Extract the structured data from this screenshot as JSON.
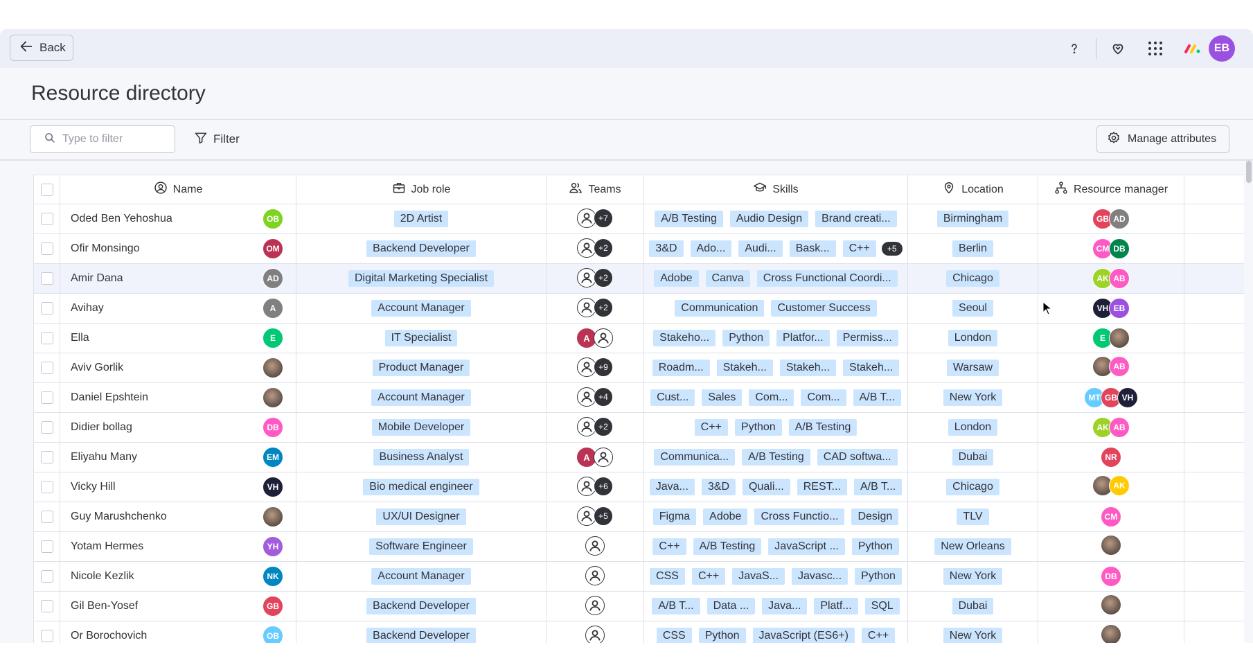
{
  "topbar": {
    "back_label": "Back",
    "user_initials": "EB",
    "user_color": "#9b51e0",
    "icons": [
      "help-icon",
      "heart-icon",
      "apps-grid-icon",
      "monday-logo-icon"
    ]
  },
  "page": {
    "title": "Resource directory"
  },
  "toolbar": {
    "search_placeholder": "Type to filter",
    "filter_label": "Filter",
    "manage_label": "Manage attributes"
  },
  "columns": {
    "name": "Name",
    "job_role": "Job role",
    "teams": "Teams",
    "skills": "Skills",
    "location": "Location",
    "resource_manager": "Resource manager"
  },
  "rows": [
    {
      "name": "Oded Ben Yehoshua",
      "initials": "OB",
      "color": "#7ed321",
      "role": "2D Artist",
      "teams": {
        "more": "+7"
      },
      "skills": [
        "A/B Testing",
        "Audio Design",
        "Brand creati..."
      ],
      "skills_more": "",
      "location": "Birmingham",
      "managers": [
        {
          "initials": "GB",
          "color": "#e2445c"
        },
        {
          "initials": "AD",
          "color": "#808080"
        }
      ]
    },
    {
      "name": "Ofir Monsingo",
      "initials": "OM",
      "color": "#bb3354",
      "role": "Backend Developer",
      "teams": {
        "more": "+2"
      },
      "skills": [
        "3&D",
        "Ado...",
        "Audi...",
        "Bask...",
        "C++"
      ],
      "skills_more": "+5",
      "location": "Berlin",
      "managers": [
        {
          "initials": "CM",
          "color": "#ff5ac4"
        },
        {
          "initials": "DB",
          "color": "#00854d"
        }
      ]
    },
    {
      "name": "Amir Dana",
      "initials": "AD",
      "color": "#808080",
      "role": "Digital Marketing Specialist",
      "teams": {
        "more": "+2"
      },
      "skills": [
        "Adobe",
        "Canva",
        "Cross Functional Coordi..."
      ],
      "skills_more": "",
      "location": "Chicago",
      "managers": [
        {
          "initials": "AK",
          "color": "#9cd326"
        },
        {
          "initials": "AB",
          "color": "#ff5ac4"
        }
      ]
    },
    {
      "name": "Avihay",
      "initials": "A",
      "color": "#808080",
      "role": "Account Manager",
      "teams": {
        "more": "+2"
      },
      "skills": [
        "Communication",
        "Customer Success"
      ],
      "skills_more": "",
      "location": "Seoul",
      "managers": [
        {
          "initials": "VH",
          "color": "#1f1f3a"
        },
        {
          "initials": "EB",
          "color": "#9b51e0"
        }
      ]
    },
    {
      "name": "Ella",
      "initials": "E",
      "color": "#00c875",
      "role": "IT Specialist",
      "teams": {
        "red": "A"
      },
      "skills": [
        "Stakeho...",
        "Python",
        "Platfor...",
        "Permiss..."
      ],
      "skills_more": "",
      "location": "London",
      "managers": [
        {
          "initials": "E",
          "color": "#00c875"
        },
        {
          "initials": "",
          "color": "photo"
        }
      ]
    },
    {
      "name": "Aviv Gorlik",
      "initials": "",
      "color": "photo",
      "role": "Product Manager",
      "teams": {
        "more": "+9"
      },
      "skills": [
        "Roadm...",
        "Stakeh...",
        "Stakeh...",
        "Stakeh..."
      ],
      "skills_more": "",
      "location": "Warsaw",
      "managers": [
        {
          "initials": "",
          "color": "photo"
        },
        {
          "initials": "AB",
          "color": "#ff5ac4"
        }
      ]
    },
    {
      "name": "Daniel Epshtein",
      "initials": "",
      "color": "photo",
      "role": "Account Manager",
      "teams": {
        "more": "+4"
      },
      "skills": [
        "Cust...",
        "Sales",
        "Com...",
        "Com...",
        "A/B T..."
      ],
      "skills_more": "",
      "location": "New York",
      "managers": [
        {
          "initials": "MT",
          "color": "#66ccff"
        },
        {
          "initials": "GB",
          "color": "#e2445c"
        },
        {
          "initials": "VH",
          "color": "#1f1f3a"
        }
      ]
    },
    {
      "name": "Didier bollag",
      "initials": "DB",
      "color": "#ff5ac4",
      "role": "Mobile Developer",
      "teams": {
        "more": "+2"
      },
      "skills": [
        "C++",
        "Python",
        "A/B Testing"
      ],
      "skills_more": "",
      "location": "London",
      "managers": [
        {
          "initials": "AK",
          "color": "#9cd326"
        },
        {
          "initials": "AB",
          "color": "#ff5ac4"
        }
      ]
    },
    {
      "name": "Eliyahu Many",
      "initials": "EM",
      "color": "#0086c0",
      "role": "Business Analyst",
      "teams": {
        "red": "A"
      },
      "skills": [
        "Communica...",
        "A/B Testing",
        "CAD softwa..."
      ],
      "skills_more": "",
      "location": "Dubai",
      "managers": [
        {
          "initials": "NR",
          "color": "#e2445c"
        }
      ]
    },
    {
      "name": "Vicky Hill",
      "initials": "VH",
      "color": "#1f1f3a",
      "role": "Bio medical engineer",
      "teams": {
        "more": "+6"
      },
      "skills": [
        "Java...",
        "3&D",
        "Quali...",
        "REST...",
        "A/B T..."
      ],
      "skills_more": "",
      "location": "Chicago",
      "managers": [
        {
          "initials": "",
          "color": "photo"
        },
        {
          "initials": "AK",
          "color": "#ffcb00"
        }
      ]
    },
    {
      "name": "Guy Marushchenko",
      "initials": "",
      "color": "photo",
      "role": "UX/UI Designer",
      "teams": {
        "more": "+5"
      },
      "skills": [
        "Figma",
        "Adobe",
        "Cross Functio...",
        "Design"
      ],
      "skills_more": "",
      "location": "TLV",
      "managers": [
        {
          "initials": "CM",
          "color": "#ff5ac4"
        }
      ]
    },
    {
      "name": "Yotam Hermes",
      "initials": "YH",
      "color": "#a25ddc",
      "role": "Software Engineer",
      "teams": {},
      "skills": [
        "C++",
        "A/B Testing",
        "JavaScript ...",
        "Python"
      ],
      "skills_more": "",
      "location": "New Orleans",
      "managers": [
        {
          "initials": "",
          "color": "photo"
        }
      ]
    },
    {
      "name": "Nicole Kezlik",
      "initials": "NK",
      "color": "#0086c0",
      "role": "Account Manager",
      "teams": {},
      "skills": [
        "CSS",
        "C++",
        "JavaS...",
        "Javasc...",
        "Python"
      ],
      "skills_more": "",
      "location": "New York",
      "managers": [
        {
          "initials": "DB",
          "color": "#ff5ac4"
        }
      ]
    },
    {
      "name": "Gil Ben-Yosef",
      "initials": "GB",
      "color": "#e2445c",
      "role": "Backend Developer",
      "teams": {},
      "skills": [
        "A/B T...",
        "Data ...",
        "Java...",
        "Platf...",
        "SQL"
      ],
      "skills_more": "",
      "location": "Dubai",
      "managers": [
        {
          "initials": "",
          "color": "photo"
        }
      ]
    },
    {
      "name": "Or Borochovich",
      "initials": "OB",
      "color": "#66ccff",
      "role": "Backend Developer",
      "teams": {},
      "skills": [
        "CSS",
        "Python",
        "JavaScript (ES6+)",
        "C++"
      ],
      "skills_more": "",
      "location": "New York",
      "managers": [
        {
          "initials": "",
          "color": "photo"
        }
      ]
    }
  ]
}
